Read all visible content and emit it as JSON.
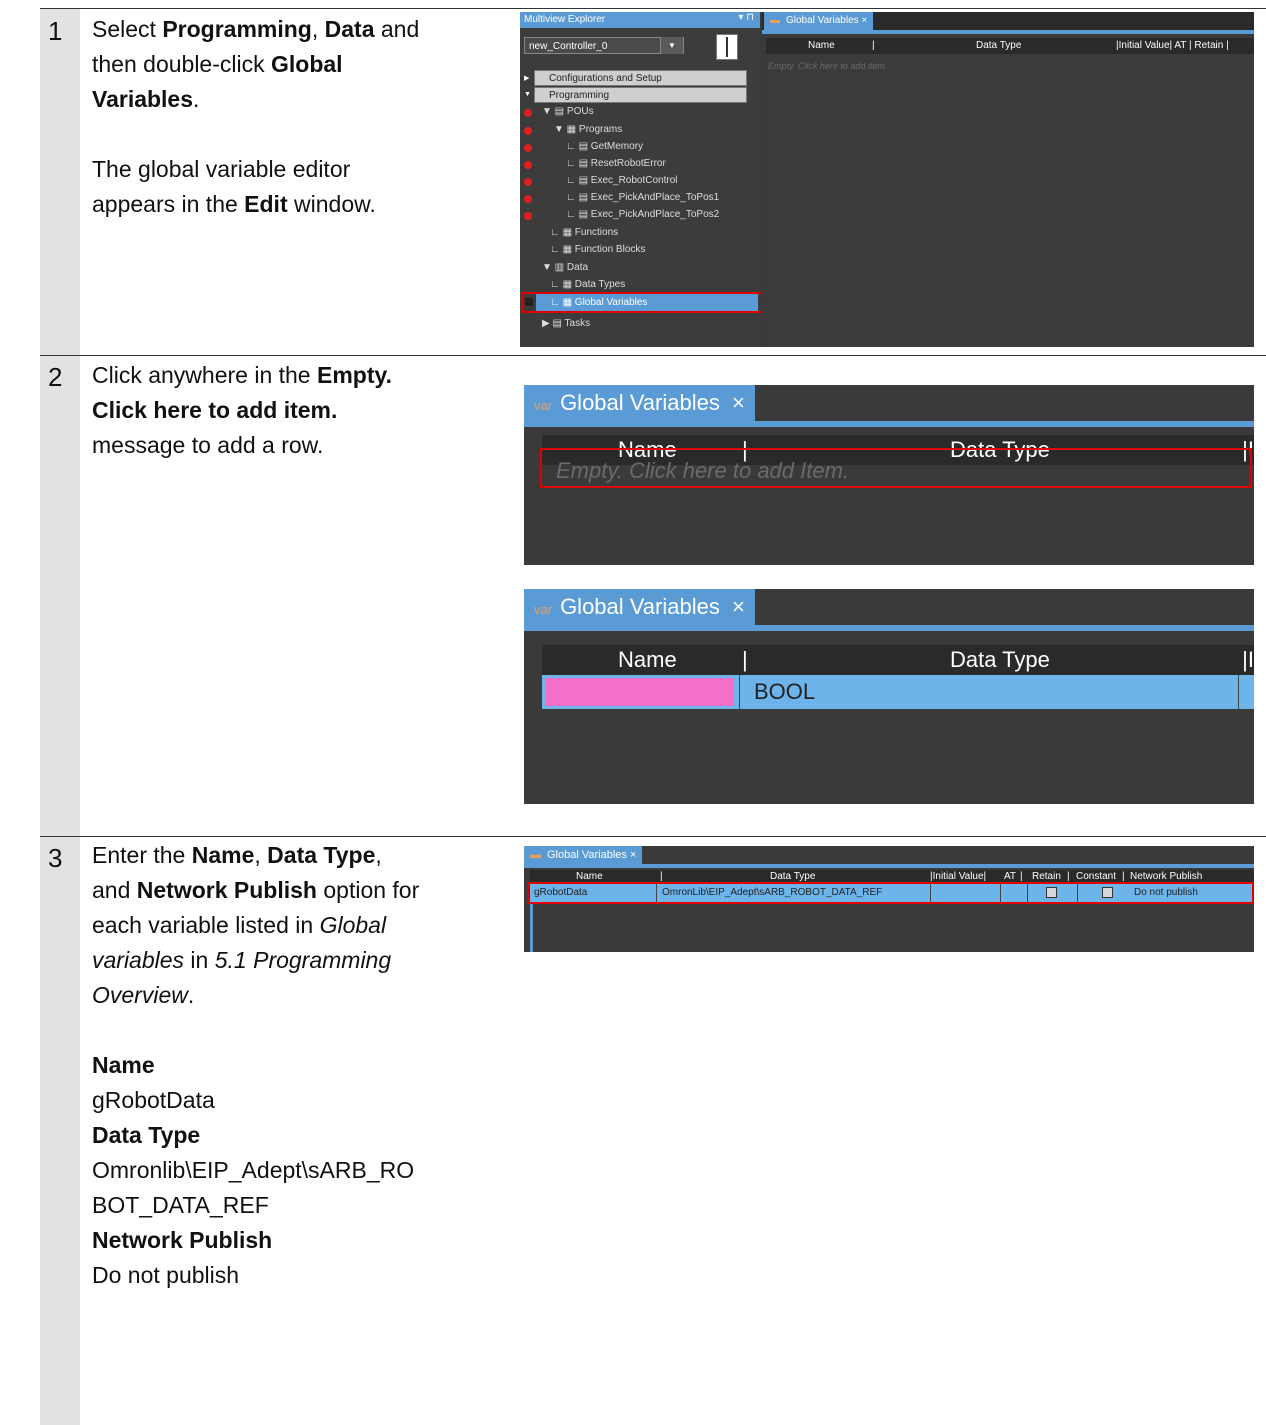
{
  "steps": [
    {
      "number": "1",
      "lines": [
        [
          "Select ",
          "Programming",
          ", ",
          "Data",
          " and"
        ],
        [
          "then double-click ",
          "Global"
        ],
        [
          "Variables",
          "."
        ],
        [
          ""
        ],
        [
          "The global variable editor"
        ],
        [
          "appears in the ",
          "Edit",
          " window."
        ]
      ]
    },
    {
      "number": "2",
      "lines": [
        [
          "Click anywhere in the ",
          "Empty."
        ],
        [
          "Click here to add item."
        ],
        [
          "message to add a row."
        ]
      ]
    },
    {
      "number": "3",
      "lines": [
        [
          "Enter the ",
          "Name",
          ", ",
          "Data Type",
          ","
        ],
        [
          "and ",
          "Network Publish",
          " option for"
        ],
        [
          "each variable listed in ",
          "Global"
        ],
        [
          "variables",
          " in ",
          "5.1 Programming"
        ],
        [
          "Overview",
          "."
        ]
      ],
      "fields": [
        {
          "label": "Name",
          "value": "gRobotData"
        },
        {
          "label": "Data Type",
          "value_lines": [
            "Omronlib\\EIP_Adept\\sARB_RO",
            "BOT_DATA_REF"
          ]
        },
        {
          "label": "Network Publish",
          "value": "Do not publish"
        }
      ]
    }
  ],
  "shot1": {
    "explorer_title": "Multiview Explorer",
    "pin": "▾ ⊓",
    "controller": "new_Controller_0",
    "groups": [
      "Configurations and Setup",
      "Programming"
    ],
    "tree": [
      "POUs",
      "Programs",
      "GetMemory",
      "ResetRobotError",
      "Exec_RobotControl",
      "Exec_PickAndPlace_ToPos1",
      "Exec_PickAndPlace_ToPos2",
      "Functions",
      "Function Blocks",
      "Data",
      "Data Types",
      "Global Variables",
      "Tasks"
    ],
    "tab": "Global Variables",
    "col_name": "Name",
    "col_type": "Data Type",
    "col_rest": "|Initial Value| AT | Retain |",
    "empty": "Empty. Click here to add item."
  },
  "shot2": {
    "tab_icon": "var",
    "tab": "Global Variables",
    "close": "×",
    "col_name": "Name",
    "col_type": "Data Type",
    "col_end": "|I",
    "empty": "Empty. Click here to add Item."
  },
  "shot3": {
    "tab_icon": "var",
    "tab": "Global Variables",
    "close": "×",
    "col_name": "Name",
    "col_type": "Data Type",
    "col_end": "|I",
    "row_type": "BOOL"
  },
  "shot4": {
    "tab": "Global Variables",
    "close": "×",
    "headers": [
      "Name",
      "Data Type",
      "|Initial Value|",
      "AT",
      "Retain",
      "Constant",
      "Network Publish"
    ],
    "row": {
      "name": "gRobotData",
      "type": "OmronLib\\EIP_Adept\\sARB_ROBOT_DATA_REF",
      "publish": "Do not publish"
    }
  }
}
